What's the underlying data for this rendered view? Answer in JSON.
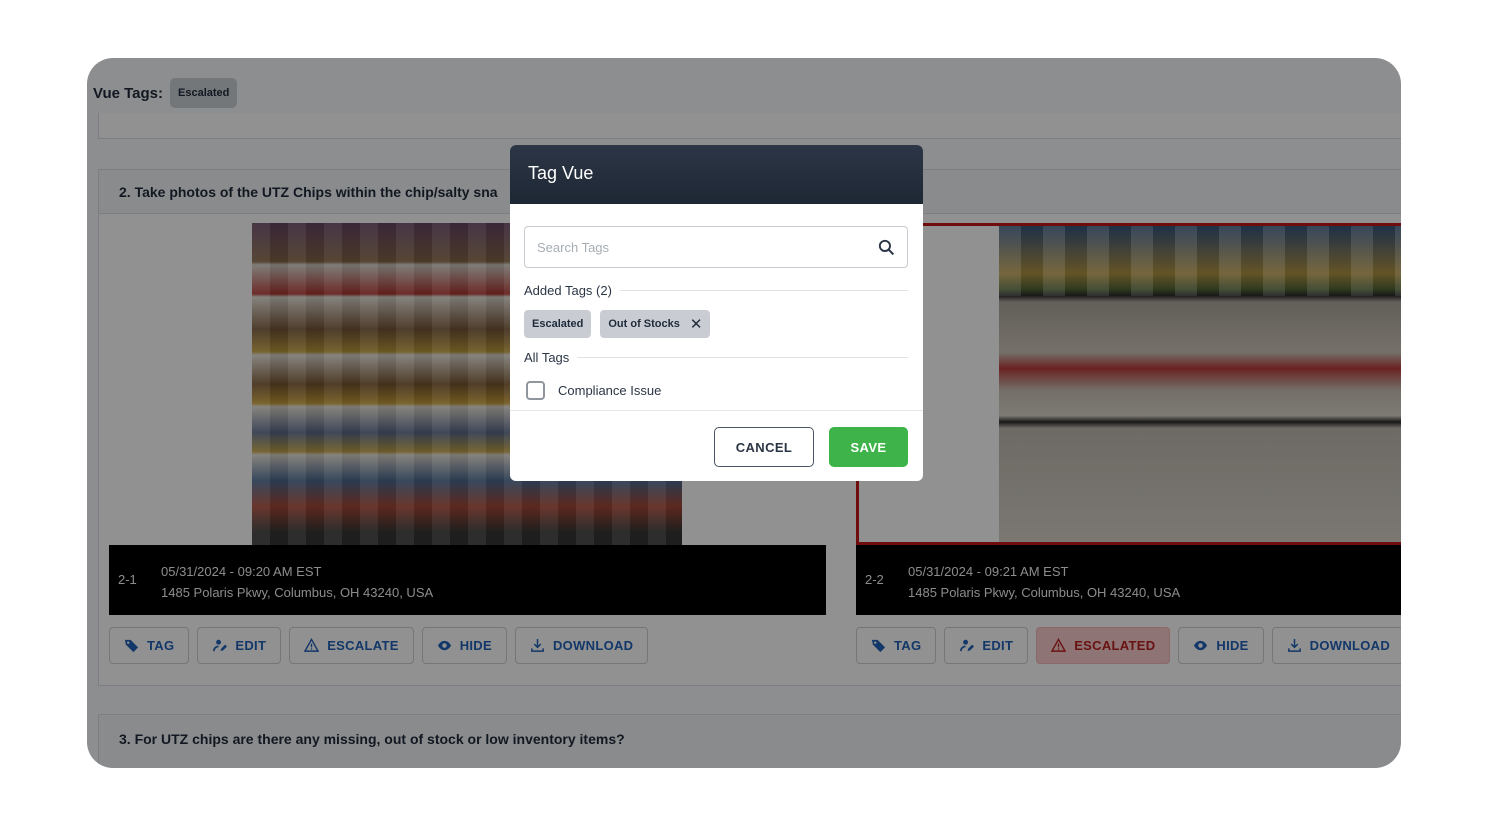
{
  "vue_tags": {
    "label": "Vue Tags:",
    "chip": "Escalated"
  },
  "section2": {
    "title": "2. Take photos of the UTZ Chips within the chip/salty sna",
    "photos": [
      {
        "number": "2-1",
        "datetime": "05/31/2024 - 09:20 AM EST",
        "address": "1485 Polaris Pkwy, Columbus, OH 43240, USA"
      },
      {
        "number": "2-2",
        "datetime": "05/31/2024 - 09:21 AM EST",
        "address": "1485 Polaris Pkwy, Columbus, OH 43240, USA"
      }
    ],
    "actions_1": {
      "tag": "TAG",
      "edit": "EDIT",
      "escalate": "ESCALATE",
      "hide": "HIDE",
      "download": "DOWNLOAD"
    },
    "actions_2": {
      "tag": "TAG",
      "edit": "EDIT",
      "escalated": "ESCALATED",
      "hide": "HIDE",
      "download": "DOWNLOAD"
    }
  },
  "section3": {
    "title": "3. For UTZ chips are there any missing, out of stock or low inventory items?"
  },
  "modal": {
    "title": "Tag Vue",
    "search_placeholder": "Search Tags",
    "added_label": "Added Tags (2)",
    "added_tags": [
      "Escalated",
      "Out of Stocks"
    ],
    "all_label": "All Tags",
    "all_tags": [
      "Compliance Issue"
    ],
    "cancel": "CANCEL",
    "save": "SAVE"
  },
  "colors": {
    "save_green": "#3db34a",
    "escalated_red": "#b52020",
    "link_blue": "#1f5fb4"
  }
}
